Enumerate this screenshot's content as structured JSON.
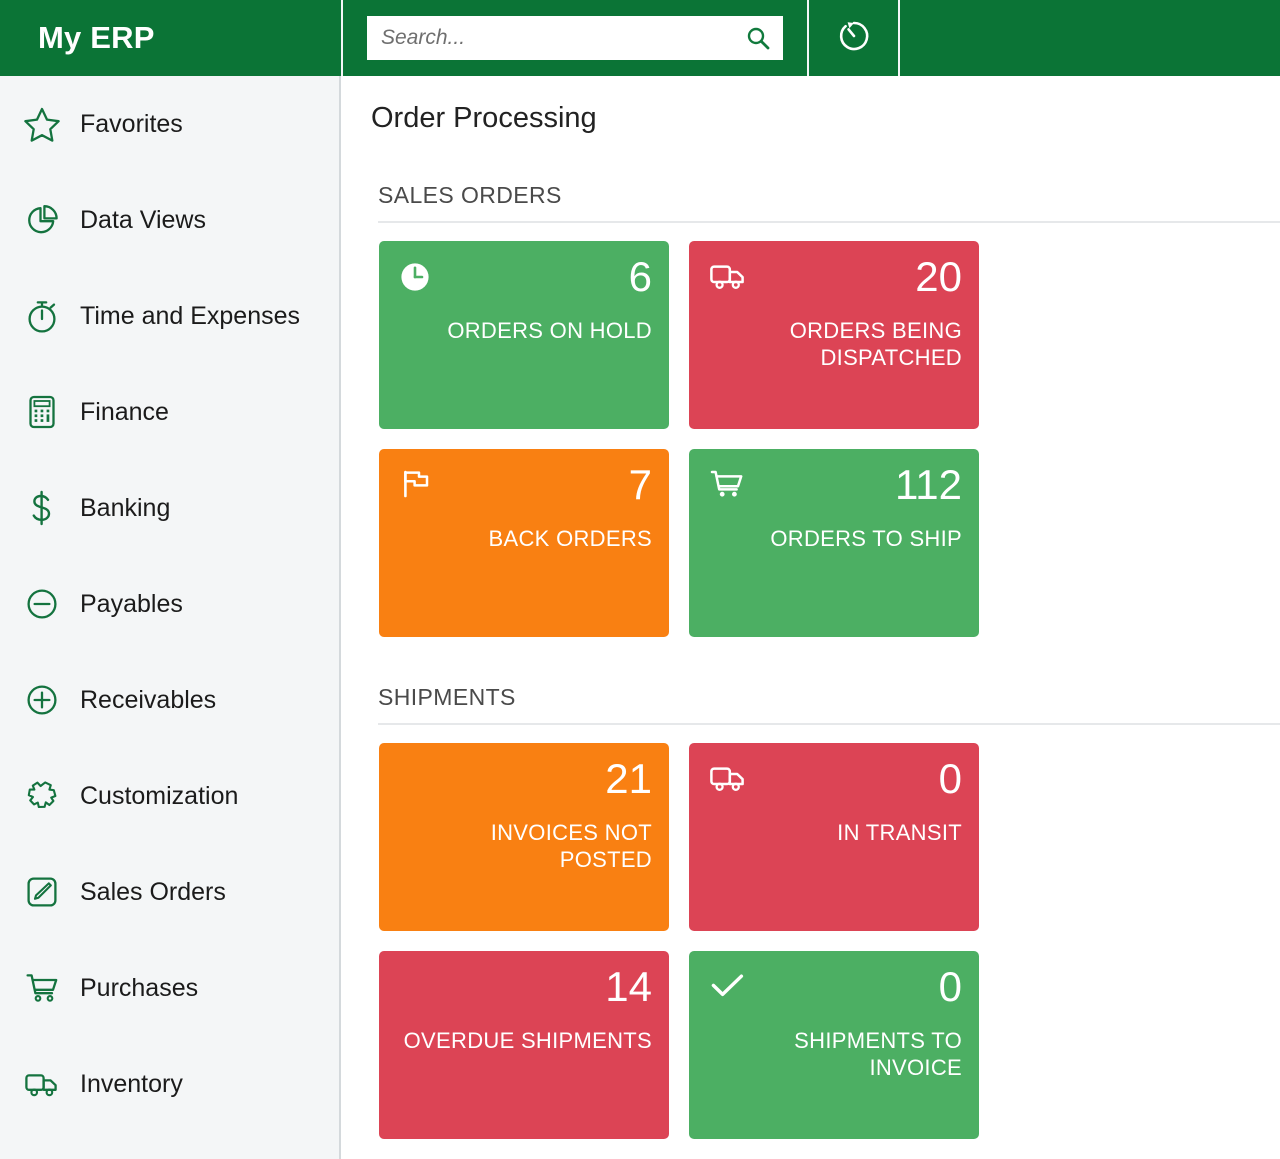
{
  "header": {
    "brand": "My ERP",
    "search": {
      "placeholder": "Search...",
      "value": "",
      "icon": "search-icon"
    },
    "timer_icon": "timer-refresh-icon"
  },
  "sidebar": {
    "items": [
      {
        "label": "Favorites",
        "icon": "star-icon"
      },
      {
        "label": "Data Views",
        "icon": "pie-chart-icon"
      },
      {
        "label": "Time and Expenses",
        "icon": "stopwatch-icon"
      },
      {
        "label": "Finance",
        "icon": "calculator-icon"
      },
      {
        "label": "Banking",
        "icon": "dollar-icon"
      },
      {
        "label": "Payables",
        "icon": "minus-circle-icon"
      },
      {
        "label": "Receivables",
        "icon": "plus-circle-icon"
      },
      {
        "label": "Customization",
        "icon": "puzzle-piece-icon"
      },
      {
        "label": "Sales Orders",
        "icon": "pencil-square-icon"
      },
      {
        "label": "Purchases",
        "icon": "shopping-cart-icon"
      },
      {
        "label": "Inventory",
        "icon": "truck-icon"
      }
    ]
  },
  "main": {
    "page_title": "Order Processing",
    "sections": [
      {
        "title": "SALES ORDERS",
        "tiles": [
          {
            "value": "6",
            "label": "ORDERS ON HOLD",
            "color": "#4caf63",
            "color_class": "t-green",
            "icon": "clock-icon"
          },
          {
            "value": "20",
            "label": "ORDERS BEING DISPATCHED",
            "color": "#dc4455",
            "color_class": "t-red",
            "icon": "truck-icon"
          },
          {
            "value": "7",
            "label": "BACK ORDERS",
            "color": "#f98012",
            "color_class": "t-orange",
            "icon": "flag-icon"
          },
          {
            "value": "112",
            "label": "ORDERS TO SHIP",
            "color": "#4caf63",
            "color_class": "t-green",
            "icon": "shopping-cart-icon"
          }
        ]
      },
      {
        "title": "SHIPMENTS",
        "tiles": [
          {
            "value": "21",
            "label": "INVOICES NOT POSTED",
            "color": "#f98012",
            "color_class": "t-orange",
            "icon": "none"
          },
          {
            "value": "0",
            "label": "IN TRANSIT",
            "color": "#dc4455",
            "color_class": "t-red",
            "icon": "truck-icon"
          },
          {
            "value": "14",
            "label": "OVERDUE SHIPMENTS",
            "color": "#dc4455",
            "color_class": "t-red",
            "icon": "none"
          },
          {
            "value": "0",
            "label": "SHIPMENTS TO INVOICE",
            "color": "#4caf63",
            "color_class": "t-green",
            "icon": "check-icon"
          }
        ]
      }
    ]
  },
  "theme": {
    "header_green": "#0b7436",
    "accent_green": "#1b8a46",
    "sidebar_bg": "#f4f6f7",
    "tile_green": "#4caf63",
    "tile_red": "#dc4455",
    "tile_orange": "#f98012"
  }
}
